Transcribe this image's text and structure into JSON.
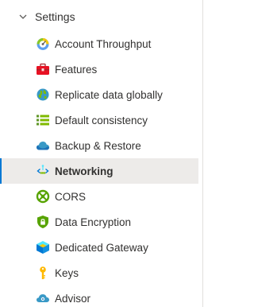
{
  "section": {
    "title": "Settings",
    "expanded": true
  },
  "items": [
    {
      "label": "Account Throughput",
      "icon": "gauge-icon"
    },
    {
      "label": "Features",
      "icon": "toolbox-icon"
    },
    {
      "label": "Replicate data globally",
      "icon": "globe-icon"
    },
    {
      "label": "Default consistency",
      "icon": "lines-icon"
    },
    {
      "label": "Backup & Restore",
      "icon": "cloud-backup-icon"
    },
    {
      "label": "Networking",
      "icon": "network-icon",
      "selected": true
    },
    {
      "label": "CORS",
      "icon": "cors-icon"
    },
    {
      "label": "Data Encryption",
      "icon": "shield-icon"
    },
    {
      "label": "Dedicated Gateway",
      "icon": "gateway-icon"
    },
    {
      "label": "Keys",
      "icon": "key-icon"
    },
    {
      "label": "Advisor",
      "icon": "advisor-icon"
    }
  ],
  "colors": {
    "selected_bg": "#edebe9",
    "accent": "#0078d4",
    "text": "#323130"
  }
}
